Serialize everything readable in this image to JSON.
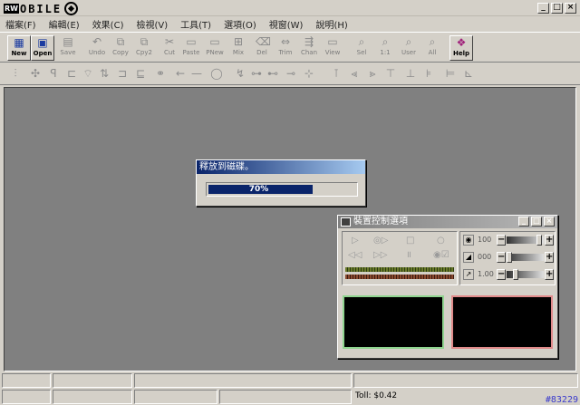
{
  "app": {
    "logo_box": "RW",
    "logo_text": "OBILE"
  },
  "window_buttons": [
    "_",
    "□",
    "×"
  ],
  "menu": [
    "檔案(F)",
    "編輯(E)",
    "效果(C)",
    "檢視(V)",
    "工具(T)",
    "選項(O)",
    "視窗(W)",
    "說明(H)"
  ],
  "toolbar": [
    {
      "label": "New",
      "icon": "new-file-icon",
      "glyph": "▦",
      "active": true
    },
    {
      "label": "Open",
      "icon": "open-icon",
      "glyph": "▣",
      "active": true
    },
    {
      "label": "Save",
      "icon": "save-icon",
      "glyph": "▤",
      "active": false
    },
    {
      "label": "Undo",
      "icon": "undo-icon",
      "glyph": "↶",
      "active": false
    },
    {
      "label": "Copy",
      "icon": "copy-icon",
      "glyph": "⧉",
      "active": false
    },
    {
      "label": "Cpy2",
      "icon": "copy2-icon",
      "glyph": "⧉",
      "active": false
    },
    {
      "label": "Cut",
      "icon": "cut-icon",
      "glyph": "✂",
      "active": false
    },
    {
      "label": "Paste",
      "icon": "paste-icon",
      "glyph": "▭",
      "active": false
    },
    {
      "label": "PNew",
      "icon": "paste-new-icon",
      "glyph": "▭",
      "active": false
    },
    {
      "label": "Mix",
      "icon": "mix-icon",
      "glyph": "⊞",
      "active": false
    },
    {
      "label": "Del",
      "icon": "delete-icon",
      "glyph": "⌫",
      "active": false
    },
    {
      "label": "Trim",
      "icon": "trim-icon",
      "glyph": "⇔",
      "active": false
    },
    {
      "label": "Chan",
      "icon": "channel-icon",
      "glyph": "⇶",
      "active": false
    },
    {
      "label": "View",
      "icon": "view-icon",
      "glyph": "▭",
      "active": false
    },
    {
      "label": "Sel",
      "icon": "select-zoom-icon",
      "glyph": "⌕",
      "active": false
    },
    {
      "label": "1:1",
      "icon": "zoom-1-1-icon",
      "glyph": "⌕",
      "active": false
    },
    {
      "label": "User",
      "icon": "zoom-user-icon",
      "glyph": "⌕",
      "active": false
    },
    {
      "label": "All",
      "icon": "zoom-all-icon",
      "glyph": "⌕",
      "active": false
    },
    {
      "label": "Help",
      "icon": "help-book-icon",
      "glyph": "❖",
      "active": true
    }
  ],
  "toolbar2": [
    "amplify-icon",
    "normalize-icon",
    "fade-in-icon",
    "fade-out-icon",
    "crossfade-icon",
    "invert-icon",
    "reverse-icon",
    "compress-icon",
    "echo-icon",
    "tone-left-icon",
    "tone-right-icon",
    "silence-icon",
    "noise-gate-icon",
    "eq-1-icon",
    "eq-2-icon",
    "eq-3-icon",
    "eq-4-icon",
    "eq-5-icon",
    "flange-icon",
    "chorus-icon",
    "filter-1-icon",
    "filter-2-icon",
    "filter-3-icon",
    "filter-4-icon",
    "pitch-icon",
    "frequency-icon"
  ],
  "progress_dialog": {
    "title": "釋放到磁碟。",
    "percent_label": "70%",
    "progress": 0.7
  },
  "device_control": {
    "title": "裝置控制選項",
    "sliders": [
      {
        "icon": "speaker-icon",
        "value": "100",
        "level": 0.95
      },
      {
        "icon": "record-icon",
        "value": "000",
        "level": 0.0
      },
      {
        "icon": "speed-icon",
        "value": "1.00",
        "level": 0.2
      }
    ]
  },
  "status": {
    "toll": "Toll: $0.42"
  },
  "watermark": "#83229"
}
